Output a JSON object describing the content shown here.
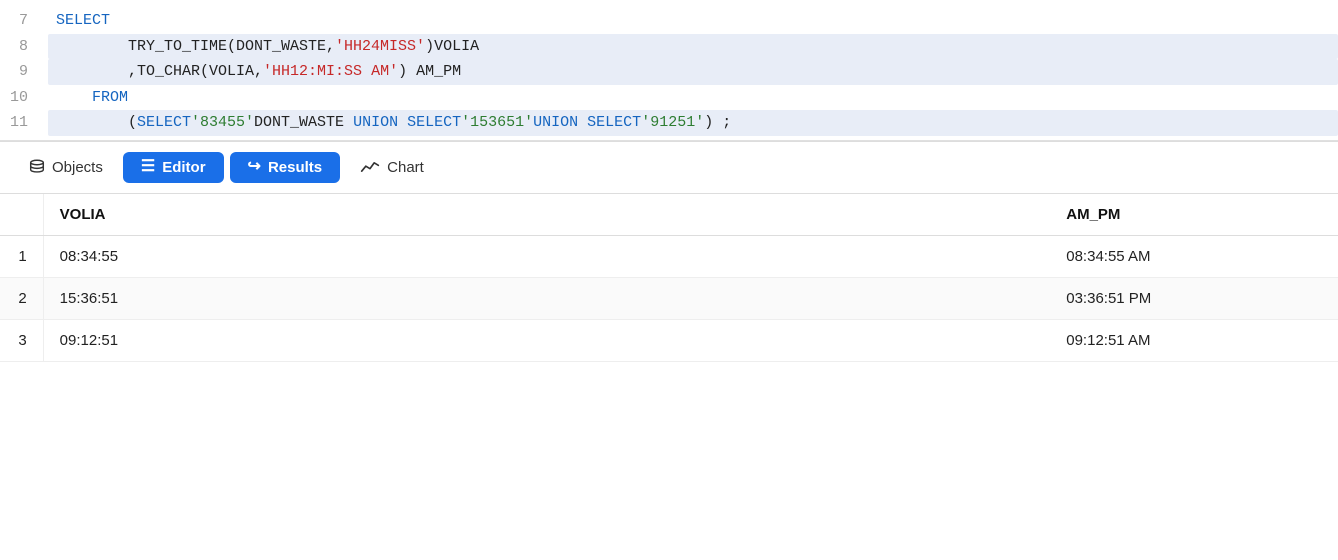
{
  "toolbar": {
    "objects_label": "Objects",
    "editor_label": "Editor",
    "results_label": "Results",
    "chart_label": "Chart"
  },
  "code": {
    "lines": [
      {
        "num": "7",
        "highlight": false,
        "tokens": [
          {
            "type": "kw",
            "text": "SELECT"
          }
        ]
      },
      {
        "num": "8",
        "highlight": true,
        "tokens": [
          {
            "type": "plain",
            "text": "        TRY_TO_TIME(DONT_WASTE,"
          },
          {
            "type": "str-red",
            "text": "'HH24MISS'"
          },
          {
            "type": "plain",
            "text": ")VOLIA"
          }
        ]
      },
      {
        "num": "9",
        "highlight": true,
        "tokens": [
          {
            "type": "plain",
            "text": "        ,TO_CHAR(VOLIA,"
          },
          {
            "type": "str-red",
            "text": "'HH12:MI:SS AM'"
          },
          {
            "type": "plain",
            "text": ") AM_PM"
          }
        ]
      },
      {
        "num": "10",
        "highlight": false,
        "tokens": [
          {
            "type": "kw",
            "text": "    FROM"
          }
        ]
      },
      {
        "num": "11",
        "highlight": true,
        "tokens": [
          {
            "type": "plain",
            "text": "        ("
          },
          {
            "type": "kw",
            "text": "SELECT"
          },
          {
            "type": "str-green",
            "text": "'83455'"
          },
          {
            "type": "plain",
            "text": "DONT_WASTE "
          },
          {
            "type": "kw",
            "text": "UNION"
          },
          {
            "type": "plain",
            "text": " "
          },
          {
            "type": "kw",
            "text": "SELECT"
          },
          {
            "type": "str-green",
            "text": "'153651'"
          },
          {
            "type": "kw",
            "text": "UNION"
          },
          {
            "type": "plain",
            "text": " "
          },
          {
            "type": "kw",
            "text": "SELECT"
          },
          {
            "type": "str-green",
            "text": "'91251'"
          },
          {
            "type": "plain",
            "text": ") ;"
          }
        ]
      }
    ]
  },
  "table": {
    "columns": [
      {
        "id": "volia",
        "label": "VOLIA"
      },
      {
        "id": "am_pm",
        "label": "AM_PM"
      }
    ],
    "rows": [
      {
        "num": "1",
        "volia": "08:34:55",
        "am_pm": "08:34:55 AM"
      },
      {
        "num": "2",
        "volia": "15:36:51",
        "am_pm": "03:36:51 PM"
      },
      {
        "num": "3",
        "volia": "09:12:51",
        "am_pm": "09:12:51 AM"
      }
    ]
  }
}
